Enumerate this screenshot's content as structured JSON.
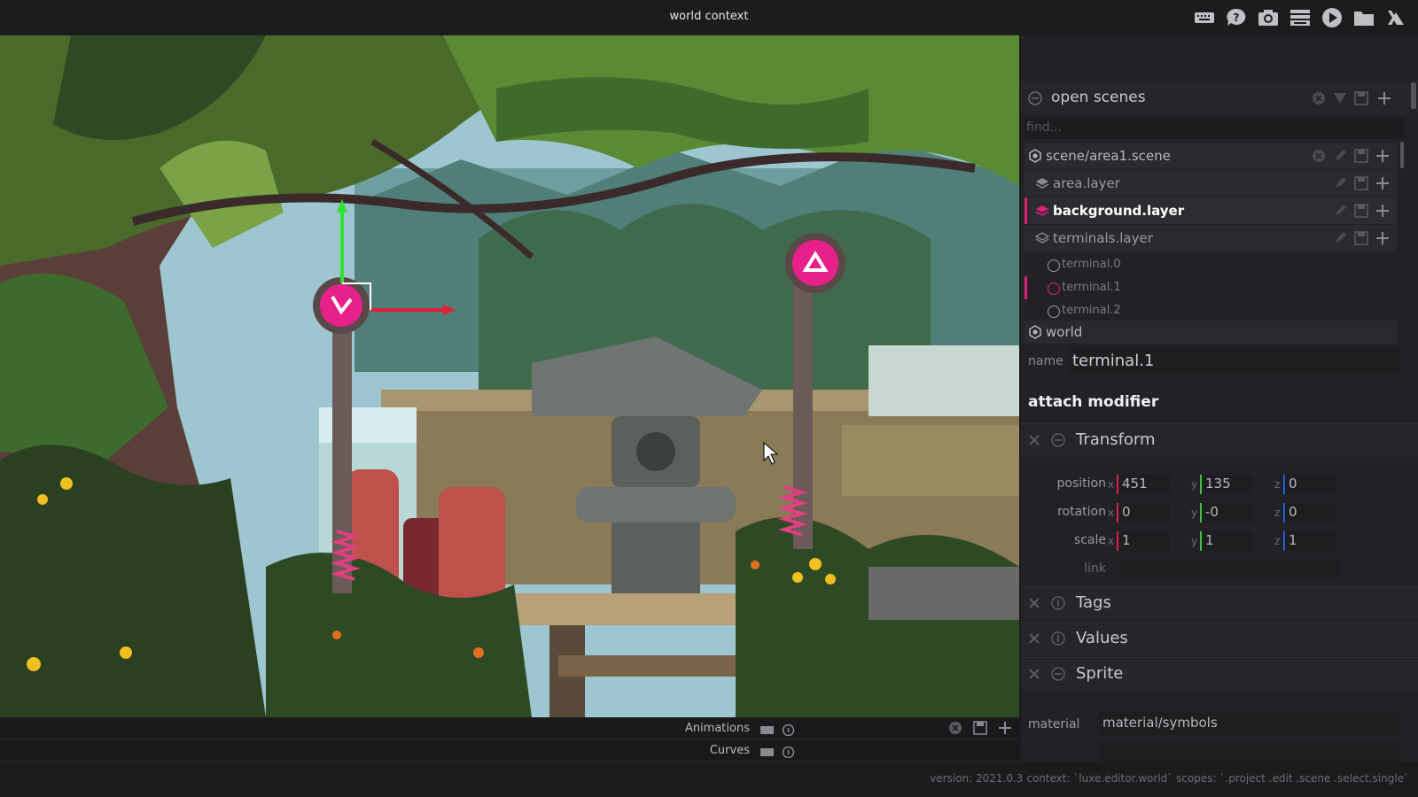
{
  "window": {
    "title": "world context"
  },
  "toolbar": {
    "icons": [
      "keyboard-icon",
      "help-icon",
      "camera-icon",
      "layers-stack-icon",
      "play-icon",
      "folder-icon",
      "luxe-logo-icon"
    ]
  },
  "timeline": {
    "rows": [
      {
        "label": "Animations"
      },
      {
        "label": "Curves"
      }
    ]
  },
  "status": {
    "text": "version: 2021.0.3 context: `luxe.editor.world` scopes: `.project .edit .scene .select.single`"
  },
  "panel": {
    "open_scenes": {
      "title": "open scenes",
      "find_placeholder": "find...",
      "tree": [
        {
          "label": "scene/area1.scene",
          "icon": "scene-icon"
        },
        {
          "label": "area.layer",
          "icon": "layers-icon"
        },
        {
          "label": "background.layer",
          "icon": "layers-icon",
          "selected": true
        },
        {
          "label": "terminals.layer",
          "icon": "layers-outline-icon"
        }
      ],
      "entities": [
        {
          "label": "terminal.0"
        },
        {
          "label": "terminal.1",
          "selected": true
        },
        {
          "label": "terminal.2"
        }
      ],
      "world": {
        "label": "world"
      }
    },
    "name": {
      "label": "name",
      "value": "terminal.1"
    },
    "attach_modifier": "attach modifier",
    "modifiers": {
      "transform": {
        "title": "Transform",
        "position": {
          "label": "position",
          "x": "451",
          "y": "135",
          "z": "0"
        },
        "rotation": {
          "label": "rotation",
          "x": "0",
          "y": "-0",
          "z": "0"
        },
        "scale": {
          "label": "scale",
          "x": "1",
          "y": "1",
          "z": "1"
        },
        "link": {
          "label": "link"
        },
        "axis_x": "x",
        "axis_y": "y",
        "axis_z": "z"
      },
      "tags": {
        "title": "Tags"
      },
      "values": {
        "title": "Values"
      },
      "sprite": {
        "title": "Sprite",
        "material_label": "material",
        "material_value": "material/symbols"
      }
    }
  },
  "colors": {
    "accent": "#e0207a",
    "axis_x": "#e0204a",
    "axis_y": "#40c040",
    "axis_z": "#2060e0"
  }
}
